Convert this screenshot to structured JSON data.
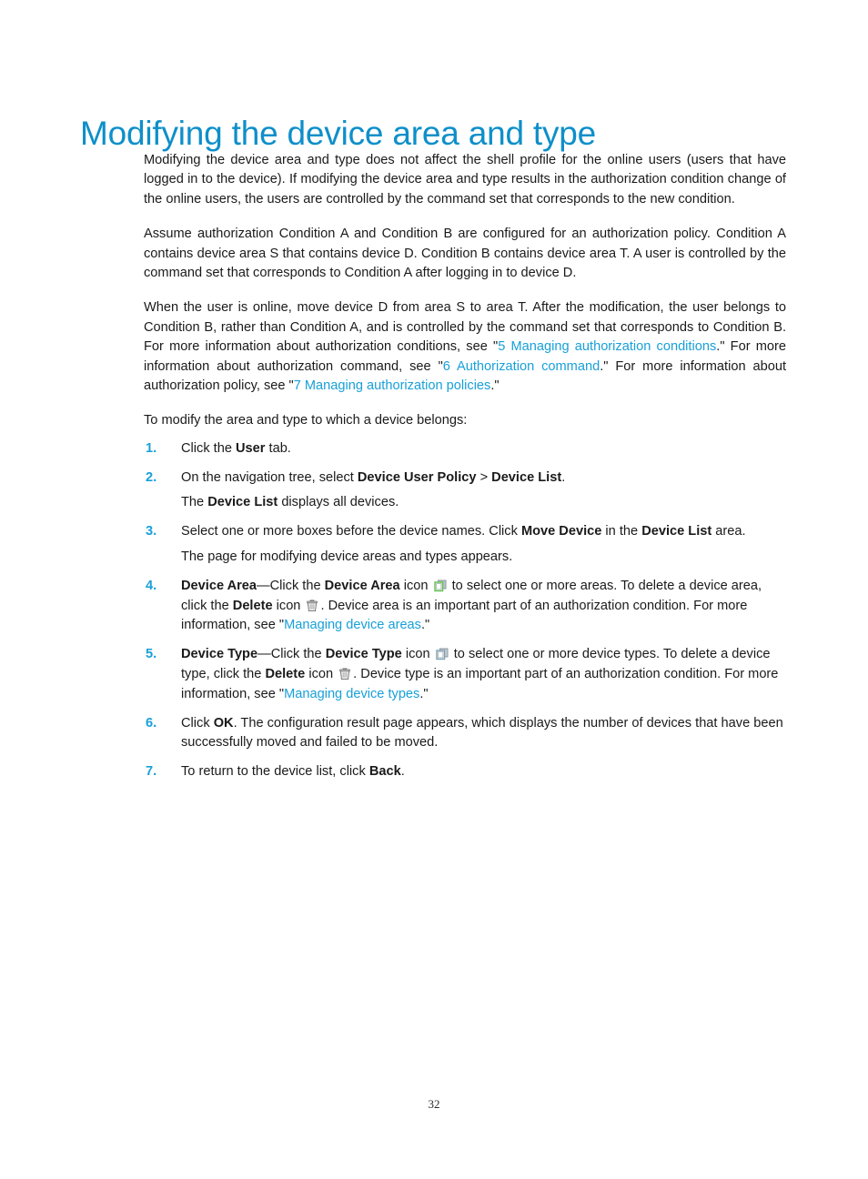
{
  "document": {
    "heading": "Modifying the device area and type",
    "page_number": "32",
    "heading_color": "#0e8fc9",
    "link_color": "#18a0d8",
    "number_color": "#18a0d8"
  },
  "paragraphs": {
    "p1": "Modifying the device area and type does not affect the shell profile for the online users (users that have logged in to the device). If modifying the device area and type results in the authorization condition change of the online users, the users are controlled by the command set that corresponds to the new condition.",
    "p2": "Assume authorization Condition A and Condition B are configured for an authorization policy. Condition A contains device area S that contains device D. Condition B contains device area T. A user is controlled by the command set that corresponds to Condition A after logging in to device D.",
    "p3_a": "When the user is online, move device D from area S to area T. After the modification, the user belongs to Condition B, rather than Condition A, and is controlled by the command set that corresponds to Condition B. For more information about authorization conditions, see \"",
    "p3_link1": "5 Managing authorization conditions",
    "p3_b": ".\" For more information about authorization command, see \"",
    "p3_link2": "6 Authorization command",
    "p3_c": ".\" For more information about authorization policy, see \"",
    "p3_link3": "7 Managing authorization policies",
    "p3_d": ".\"",
    "lead_in": "To modify the area and type to which a device belongs:"
  },
  "steps": [
    {
      "num": "1.",
      "parts": {
        "a": "Click the ",
        "bold1": "User",
        "b": " tab."
      }
    },
    {
      "num": "2.",
      "parts": {
        "a": "On the navigation tree, select ",
        "bold1": "Device User Policy",
        "b": " > ",
        "bold2": "Device List",
        "c": "."
      },
      "sub": {
        "a": "The ",
        "bold1": "Device List",
        "b": " displays all devices."
      }
    },
    {
      "num": "3.",
      "parts": {
        "a": "Select one or more boxes before the device names. Click ",
        "bold1": "Move Device",
        "b": " in the ",
        "bold2": "Device List",
        "c": " area."
      },
      "sub": {
        "a": "The page for modifying device areas and types appears.",
        "bold1": "",
        "b": ""
      }
    },
    {
      "num": "4.",
      "parts": {
        "bold0": "Device Area",
        "a": "—Click the ",
        "bold1": "Device Area",
        "b": " icon ",
        "icon1": "device-area-icon",
        "c": " to select one or more areas. To delete a device area, click the ",
        "bold2": "Delete",
        "d": " icon ",
        "icon2": "delete-trash-icon",
        "e": ". Device area is an important part of an authorization condition. For more information, see \"",
        "link": "Managing device areas",
        "f": ".\""
      }
    },
    {
      "num": "5.",
      "parts": {
        "bold0": "Device Type",
        "a": "—Click the ",
        "bold1": "Device Type",
        "b": " icon ",
        "icon1": "device-type-icon",
        "c": " to select one or more device types. To delete a device type, click the ",
        "bold2": "Delete",
        "d": " icon ",
        "icon2": "delete-trash-icon",
        "e": ". Device type is an important part of an authorization condition. For more information, see \"",
        "link": "Managing device types",
        "f": ".\""
      }
    },
    {
      "num": "6.",
      "parts": {
        "a": "Click ",
        "bold1": "OK",
        "b": ". The configuration result page appears, which displays the number of devices that have been successfully moved and failed to be moved."
      }
    },
    {
      "num": "7.",
      "parts": {
        "a": "To return to the device list, click ",
        "bold1": "Back",
        "b": "."
      }
    }
  ]
}
